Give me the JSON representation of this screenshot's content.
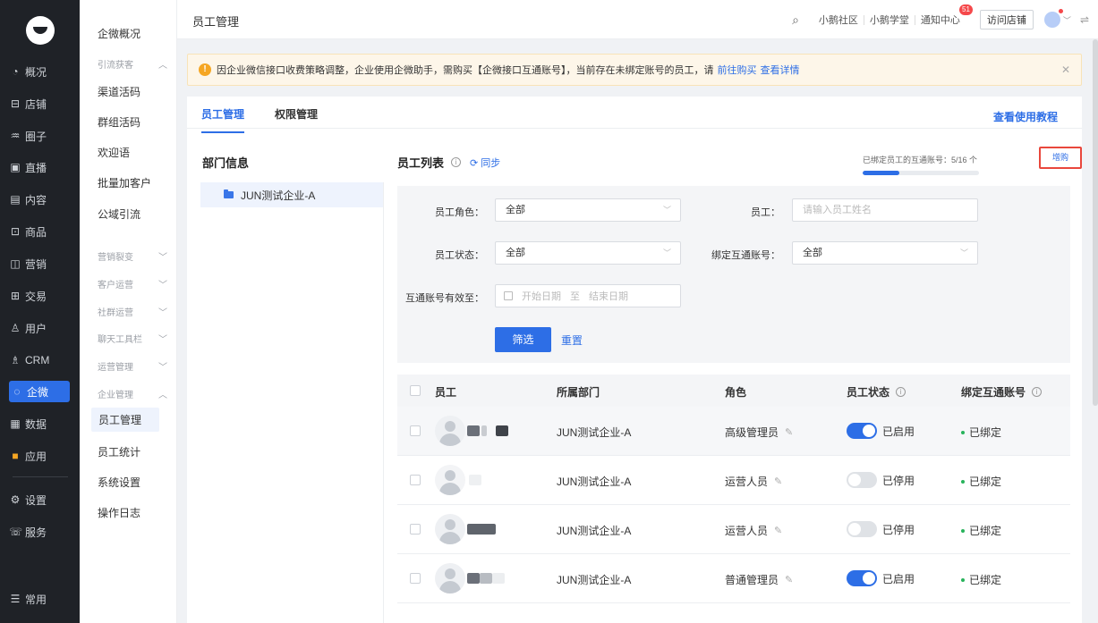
{
  "nav": {
    "items": [
      {
        "label": "概况",
        "icon": "dashboard-icon",
        "glyph": "◔"
      },
      {
        "label": "店铺",
        "icon": "store-icon",
        "glyph": "⊟"
      },
      {
        "label": "圈子",
        "icon": "circle-group-icon",
        "glyph": "♒"
      },
      {
        "label": "直播",
        "icon": "live-icon",
        "glyph": "▣"
      },
      {
        "label": "内容",
        "icon": "content-icon",
        "glyph": "▤"
      },
      {
        "label": "商品",
        "icon": "goods-icon",
        "glyph": "⊡"
      },
      {
        "label": "营销",
        "icon": "marketing-icon",
        "glyph": "◫"
      },
      {
        "label": "交易",
        "icon": "trade-icon",
        "glyph": "⊞"
      },
      {
        "label": "用户",
        "icon": "user-icon",
        "glyph": "♙"
      },
      {
        "label": "CRM",
        "icon": "crm-icon",
        "glyph": "♗"
      },
      {
        "label": "企微",
        "icon": "wecom-icon",
        "glyph": "◌"
      },
      {
        "label": "数据",
        "icon": "data-icon",
        "glyph": "▦"
      },
      {
        "label": "应用",
        "icon": "apps-icon",
        "glyph": "■"
      }
    ],
    "settings": {
      "label": "设置",
      "icon": "settings-icon",
      "glyph": "⚙"
    },
    "service": {
      "label": "服务",
      "icon": "service-icon",
      "glyph": "☏"
    },
    "common": {
      "label": "常用",
      "icon": "menu-icon",
      "glyph": "☰"
    }
  },
  "subnav": {
    "overview": "企微概况",
    "group_traffic": "引流获客",
    "channel_code": "渠道活码",
    "group_code": "群组活码",
    "welcome": "欢迎语",
    "batch_add": "批量加客户",
    "public_traffic": "公域引流",
    "group_fission": "营销裂变",
    "group_customer_ops": "客户运营",
    "group_community_ops": "社群运营",
    "group_chat_tools": "聊天工具栏",
    "group_ops_mgmt": "运营管理",
    "group_enterprise_mgmt": "企业管理",
    "staff_mgmt": "员工管理",
    "staff_stats": "员工统计",
    "system_settings": "系统设置",
    "op_log": "操作日志"
  },
  "header": {
    "title": "员工管理",
    "community": "小鹅社区",
    "academy": "小鹅学堂",
    "notifications": "通知中心",
    "notify_count": "51",
    "visit_store": "访问店铺"
  },
  "alert": {
    "text": "因企业微信接口收费策略调整，企业使用企微助手，需购买【企微接口互通账号】，当前存在未绑定账号的员工，请",
    "buy_link": "前往购买",
    "detail_link": "查看详情"
  },
  "tabs": [
    "员工管理",
    "权限管理"
  ],
  "help_link": "查看使用教程",
  "dept": {
    "title": "部门信息",
    "node": "JUN测试企业-A"
  },
  "list": {
    "title": "员工列表",
    "sync": "同步",
    "quota_label": "已绑定员工的互通账号：5/16 个",
    "quota_ratio": 0.3125,
    "buy": "增购"
  },
  "filter": {
    "role_label": "员工角色：",
    "role_value": "全部",
    "staff_label": "员工：",
    "staff_placeholder": "请输入员工姓名",
    "status_label": "员工状态：",
    "status_value": "全部",
    "bind_label": "绑定互通账号：",
    "bind_value": "全部",
    "valid_label": "互通账号有效至：",
    "date_start": "开始日期",
    "date_to": "至",
    "date_end": "结束日期",
    "submit": "筛选",
    "reset": "重置"
  },
  "table": {
    "headers": [
      "员工",
      "所属部门",
      "角色",
      "员工状态",
      "绑定互通账号"
    ],
    "rows": [
      {
        "dept": "JUN测试企业-A",
        "role": "高级管理员",
        "status": "已启用",
        "enabled": true,
        "bind": "已绑定"
      },
      {
        "dept": "JUN测试企业-A",
        "role": "运营人员",
        "status": "已停用",
        "enabled": false,
        "bind": "已绑定"
      },
      {
        "dept": "JUN测试企业-A",
        "role": "运营人员",
        "status": "已停用",
        "enabled": false,
        "bind": "已绑定"
      },
      {
        "dept": "JUN测试企业-A",
        "role": "普通管理员",
        "status": "已启用",
        "enabled": true,
        "bind": "已绑定"
      }
    ]
  }
}
